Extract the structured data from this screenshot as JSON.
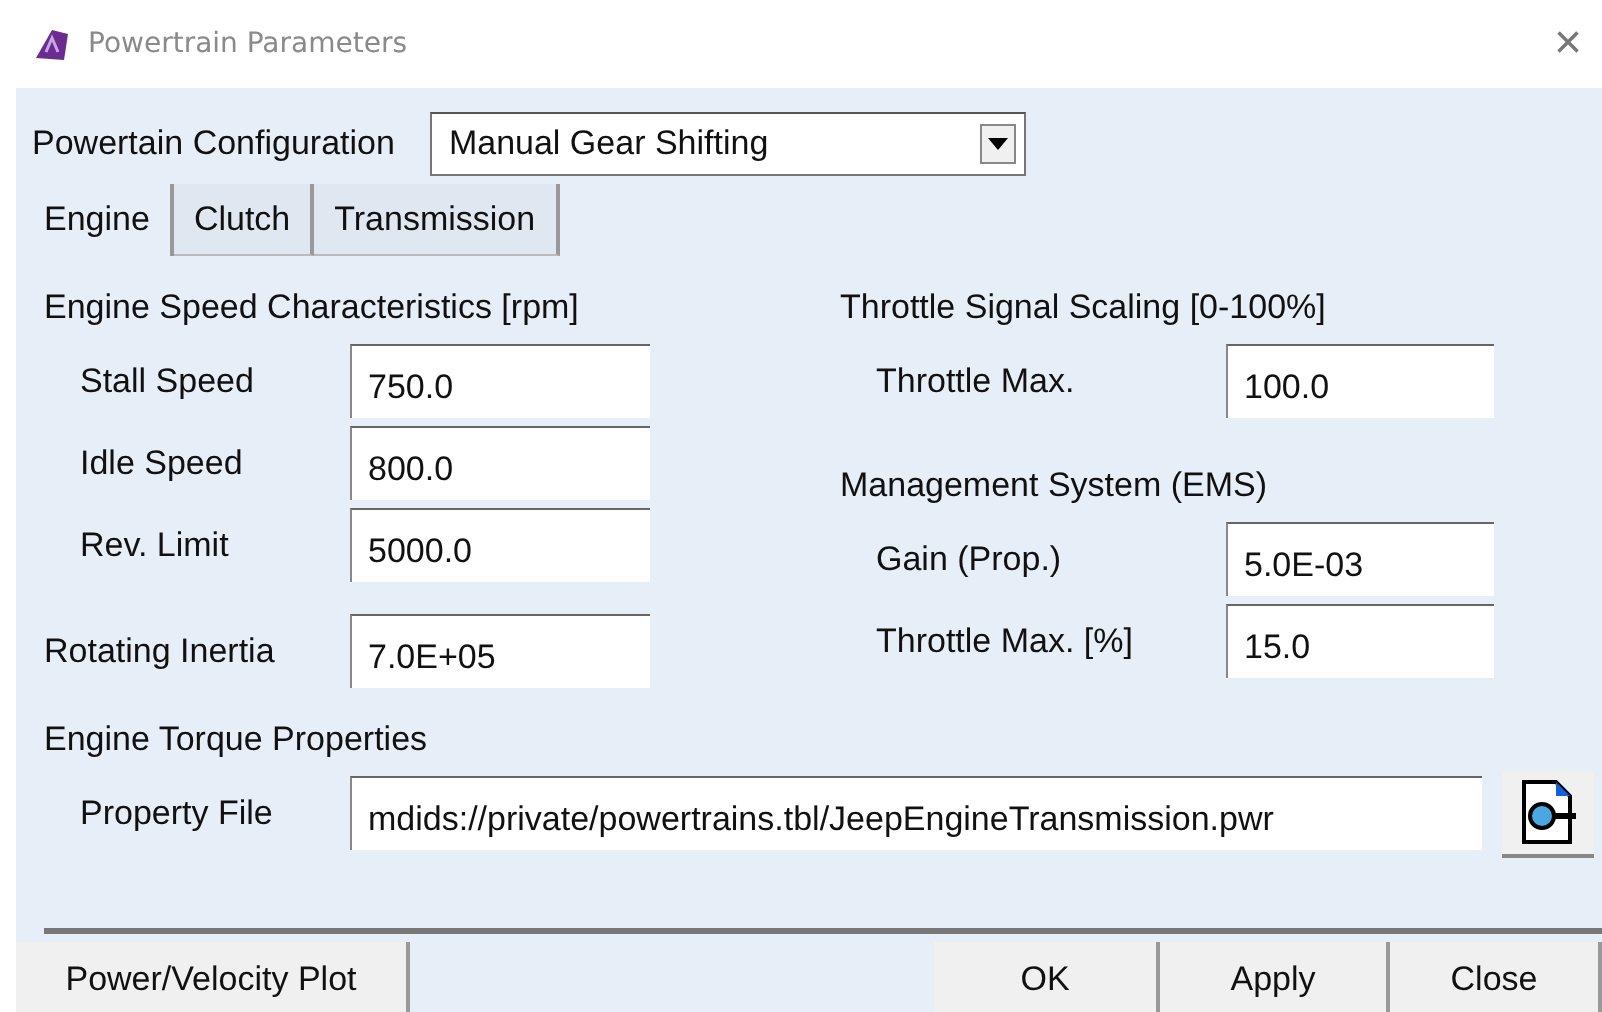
{
  "window": {
    "title": "Powertrain Parameters",
    "close": "×"
  },
  "configuration": {
    "label": "Powertain Configuration",
    "value": "Manual Gear Shifting"
  },
  "tabs": [
    {
      "label": "Engine",
      "selected": true
    },
    {
      "label": "Clutch",
      "selected": false
    },
    {
      "label": "Transmission",
      "selected": false
    }
  ],
  "speed": {
    "heading": "Engine Speed Characteristics [rpm]",
    "fields": [
      {
        "label": "Stall Speed",
        "value": "750.0"
      },
      {
        "label": "Idle Speed",
        "value": "800.0"
      },
      {
        "label": "Rev. Limit",
        "value": "5000.0"
      }
    ]
  },
  "inertia": {
    "label": "Rotating Inertia",
    "value": "7.0E+05"
  },
  "throttle": {
    "heading": "Throttle Signal Scaling [0-100%]",
    "fields": [
      {
        "label": "Throttle Max.",
        "value": "100.0"
      }
    ]
  },
  "ems": {
    "heading": "Management System (EMS)",
    "fields": [
      {
        "label": "Gain (Prop.)",
        "value": "5.0E-03"
      },
      {
        "label": "Throttle Max. [%]",
        "value": "15.0"
      }
    ]
  },
  "torque": {
    "heading": "Engine Torque Properties",
    "label": "Property File",
    "value": "mdids://private/powertrains.tbl/JeepEngineTransmission.pwr"
  },
  "buttons": [
    {
      "label": "Power/Velocity Plot",
      "kind": "left"
    },
    {
      "label": "OK",
      "kind": "right"
    },
    {
      "label": "Apply",
      "kind": "right"
    },
    {
      "label": "Close",
      "kind": "right"
    }
  ]
}
